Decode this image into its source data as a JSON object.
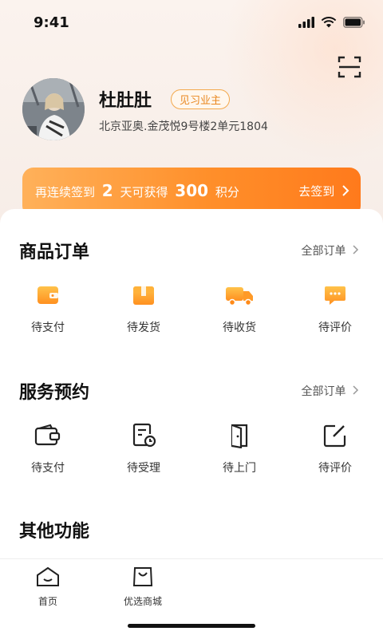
{
  "status": {
    "time": "9:41"
  },
  "profile": {
    "name": "杜肚肚",
    "role_badge": "见习业主",
    "address": "北京亚奥.金茂悦9号楼2单元1804"
  },
  "signin": {
    "prefix": "再连续签到",
    "days": "2",
    "middle": "天可获得",
    "points": "300",
    "suffix": "积分",
    "action": "去签到"
  },
  "product_orders": {
    "title": "商品订单",
    "all_link": "全部订单",
    "items": [
      {
        "label": "待支付",
        "icon": "wallet-icon"
      },
      {
        "label": "待发货",
        "icon": "box-icon"
      },
      {
        "label": "待收货",
        "icon": "truck-icon"
      },
      {
        "label": "待评价",
        "icon": "comment-icon"
      }
    ]
  },
  "service_booking": {
    "title": "服务预约",
    "all_link": "全部订单",
    "items": [
      {
        "label": "待支付",
        "icon": "wallet-outline-icon"
      },
      {
        "label": "待受理",
        "icon": "document-clock-icon"
      },
      {
        "label": "待上门",
        "icon": "door-icon"
      },
      {
        "label": "待评价",
        "icon": "edit-icon"
      }
    ]
  },
  "other": {
    "title": "其他功能"
  },
  "tabbar": {
    "items": [
      {
        "label": "首页",
        "icon": "home-icon"
      },
      {
        "label": "优选商城",
        "icon": "shopping-bag-icon"
      }
    ]
  },
  "colors": {
    "accent": "#ff8a2a",
    "accent_light": "#ffb15a"
  }
}
